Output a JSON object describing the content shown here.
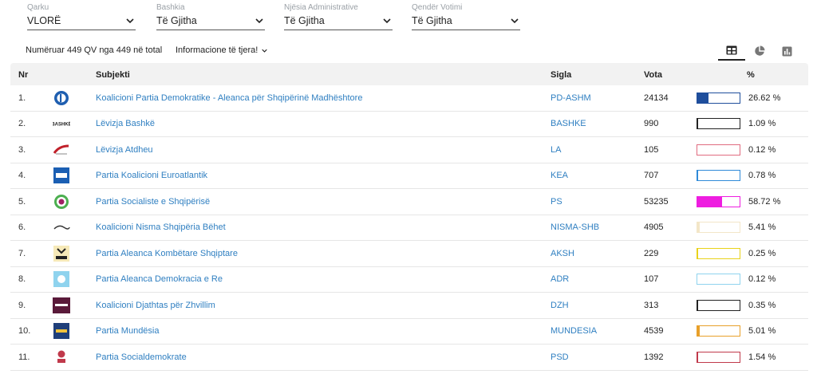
{
  "filters": [
    {
      "label": "Qarku",
      "value": "VLORË"
    },
    {
      "label": "Bashkia",
      "value": "Të Gjitha"
    },
    {
      "label": "Njësia Administrative",
      "value": "Të Gjitha"
    },
    {
      "label": "Qendër Votimi",
      "value": "Të Gjitha"
    }
  ],
  "summary": "Numëruar 449 QV nga 449 në total",
  "more_info": "Informacione të tjera!",
  "view_icons": [
    "table-icon",
    "pie-chart-icon",
    "bar-chart-icon"
  ],
  "columns": {
    "nr": "Nr",
    "subject": "Subjekti",
    "sigla": "Sigla",
    "votes": "Vota",
    "pct": "%"
  },
  "rows": [
    {
      "nr": "1.",
      "name": "Koalicioni Partia Demokratike - Aleanca për Shqipërinë Madhështore",
      "sigla": "PD-ASHM",
      "votes": "24134",
      "pct": "26.62 %",
      "share": 0.2662,
      "color": "#1f4e9c",
      "logo": "pd-logo-icon"
    },
    {
      "nr": "2.",
      "name": "Lëvizja Bashkë",
      "sigla": "BASHKE",
      "votes": "990",
      "pct": "1.09 %",
      "share": 0.0109,
      "color": "#222222",
      "logo": "bashke-logo-icon"
    },
    {
      "nr": "3.",
      "name": "Lëvizja Atdheu",
      "sigla": "LA",
      "votes": "105",
      "pct": "0.12 %",
      "share": 0.0012,
      "color": "#e06b7f",
      "logo": "la-logo-icon"
    },
    {
      "nr": "4.",
      "name": "Partia Koalicioni Euroatlantik",
      "sigla": "KEA",
      "votes": "707",
      "pct": "0.78 %",
      "share": 0.0078,
      "color": "#2f8ad8",
      "logo": "kea-logo-icon"
    },
    {
      "nr": "5.",
      "name": "Partia Socialiste e Shqipërisë",
      "sigla": "PS",
      "votes": "53235",
      "pct": "58.72 %",
      "share": 0.5872,
      "color": "#ee1de0",
      "logo": "ps-logo-icon"
    },
    {
      "nr": "6.",
      "name": "Koalicioni Nisma Shqipëria Bëhet",
      "sigla": "NISMA-SHB",
      "votes": "4905",
      "pct": "5.41 %",
      "share": 0.0541,
      "color": "#f3e6c8",
      "logo": "nisma-logo-icon"
    },
    {
      "nr": "7.",
      "name": "Partia Aleanca Kombëtare Shqiptare",
      "sigla": "AKSH",
      "votes": "229",
      "pct": "0.25 %",
      "share": 0.0025,
      "color": "#e9d21a",
      "logo": "aksh-logo-icon"
    },
    {
      "nr": "8.",
      "name": "Partia Aleanca Demokracia e Re",
      "sigla": "ADR",
      "votes": "107",
      "pct": "0.12 %",
      "share": 0.0012,
      "color": "#8fd3ee",
      "logo": "adr-logo-icon"
    },
    {
      "nr": "9.",
      "name": "Koalicioni Djathtas për Zhvillim",
      "sigla": "DZH",
      "votes": "313",
      "pct": "0.35 %",
      "share": 0.0035,
      "color": "#222222",
      "logo": "dzh-logo-icon"
    },
    {
      "nr": "10.",
      "name": "Partia Mundësia",
      "sigla": "MUNDESIA",
      "votes": "4539",
      "pct": "5.01 %",
      "share": 0.0501,
      "color": "#e8a02a",
      "logo": "mundesia-logo-icon"
    },
    {
      "nr": "11.",
      "name": "Partia Socialdemokrate",
      "sigla": "PSD",
      "votes": "1392",
      "pct": "1.54 %",
      "share": 0.0154,
      "color": "#c0394b",
      "logo": "psd-logo-icon"
    }
  ]
}
